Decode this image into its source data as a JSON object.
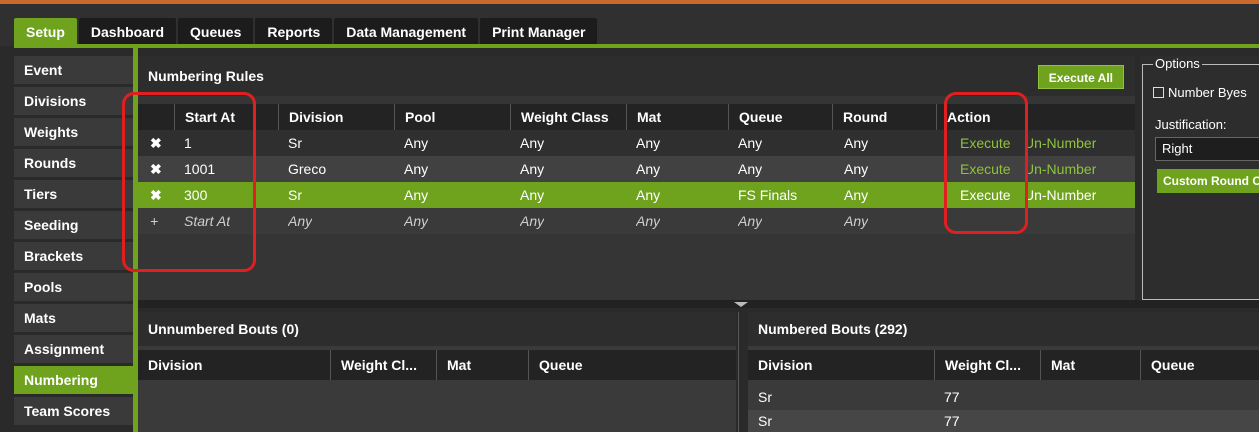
{
  "tabs": [
    "Setup",
    "Dashboard",
    "Queues",
    "Reports",
    "Data Management",
    "Print Manager"
  ],
  "sidebar": [
    "Event",
    "Divisions",
    "Weights",
    "Rounds",
    "Tiers",
    "Seeding",
    "Brackets",
    "Pools",
    "Mats",
    "Assignment",
    "Numbering",
    "Team Scores"
  ],
  "rules_panel": {
    "title": "Numbering Rules",
    "execute_all": "Execute All",
    "columns": [
      "Start At",
      "Division",
      "Pool",
      "Weight Class",
      "Mat",
      "Queue",
      "Round",
      "Action"
    ],
    "rows": [
      {
        "start": "1",
        "division": "Sr",
        "pool": "Any",
        "weight": "Any",
        "mat": "Any",
        "queue": "Any",
        "round": "Any",
        "execute": "Execute",
        "unnumber": "Un-Number"
      },
      {
        "start": "1001",
        "division": "Greco",
        "pool": "Any",
        "weight": "Any",
        "mat": "Any",
        "queue": "Any",
        "round": "Any",
        "execute": "Execute",
        "unnumber": "Un-Number"
      },
      {
        "start": "300",
        "division": "Sr",
        "pool": "Any",
        "weight": "Any",
        "mat": "Any",
        "queue": "FS Finals",
        "round": "Any",
        "execute": "Execute",
        "unnumber": "Un-Number"
      }
    ],
    "new_row": {
      "start": "Start At",
      "division": "Any",
      "pool": "Any",
      "weight": "Any",
      "mat": "Any",
      "queue": "Any",
      "round": "Any"
    },
    "remove_glyph": "✖",
    "add_glyph": "+"
  },
  "unnumbered": {
    "title": "Unnumbered Bouts (0)",
    "columns": [
      "Division",
      "Weight Cl...",
      "Mat",
      "Queue"
    ]
  },
  "numbered": {
    "title": "Numbered Bouts (292)",
    "columns": [
      "Division",
      "Weight Cl...",
      "Mat",
      "Queue"
    ],
    "rows": [
      {
        "division": "Sr",
        "weight": "77"
      },
      {
        "division": "Sr",
        "weight": "77"
      }
    ]
  },
  "options": {
    "legend": "Options",
    "number_byes": "Number Byes",
    "justification_label": "Justification:",
    "justification_value": "Right",
    "custom_round": "Custom Round C"
  },
  "colors": {
    "accent": "#6fa31e",
    "annotation": "#e02020",
    "top_stripe": "#c96a2c"
  }
}
